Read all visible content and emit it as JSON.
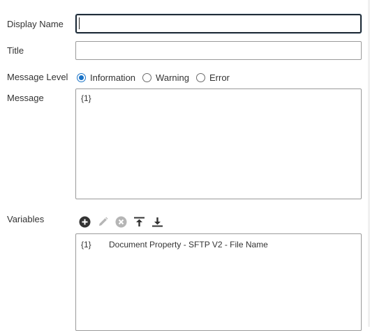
{
  "form": {
    "display_name": {
      "label": "Display Name",
      "value": ""
    },
    "title": {
      "label": "Title",
      "value": ""
    },
    "message_level": {
      "label": "Message Level",
      "options": [
        {
          "label": "Information",
          "selected": true
        },
        {
          "label": "Warning",
          "selected": false
        },
        {
          "label": "Error",
          "selected": false
        }
      ]
    },
    "message": {
      "label": "Message",
      "value": "{1}"
    },
    "variables": {
      "label": "Variables",
      "toolbar": {
        "add_icon": "plus-circle-icon",
        "edit_icon": "pencil-icon",
        "delete_icon": "x-circle-icon",
        "move_top_icon": "move-to-top-icon",
        "move_bottom_icon": "move-to-bottom-icon"
      },
      "items": [
        {
          "key": "{1}",
          "value": "Document Property - SFTP V2 - File Name"
        }
      ]
    }
  },
  "colors": {
    "accent": "#1a73c7",
    "icon_active": "#333333",
    "icon_disabled": "#b5b5b5",
    "focus_border": "#1e2a36"
  }
}
